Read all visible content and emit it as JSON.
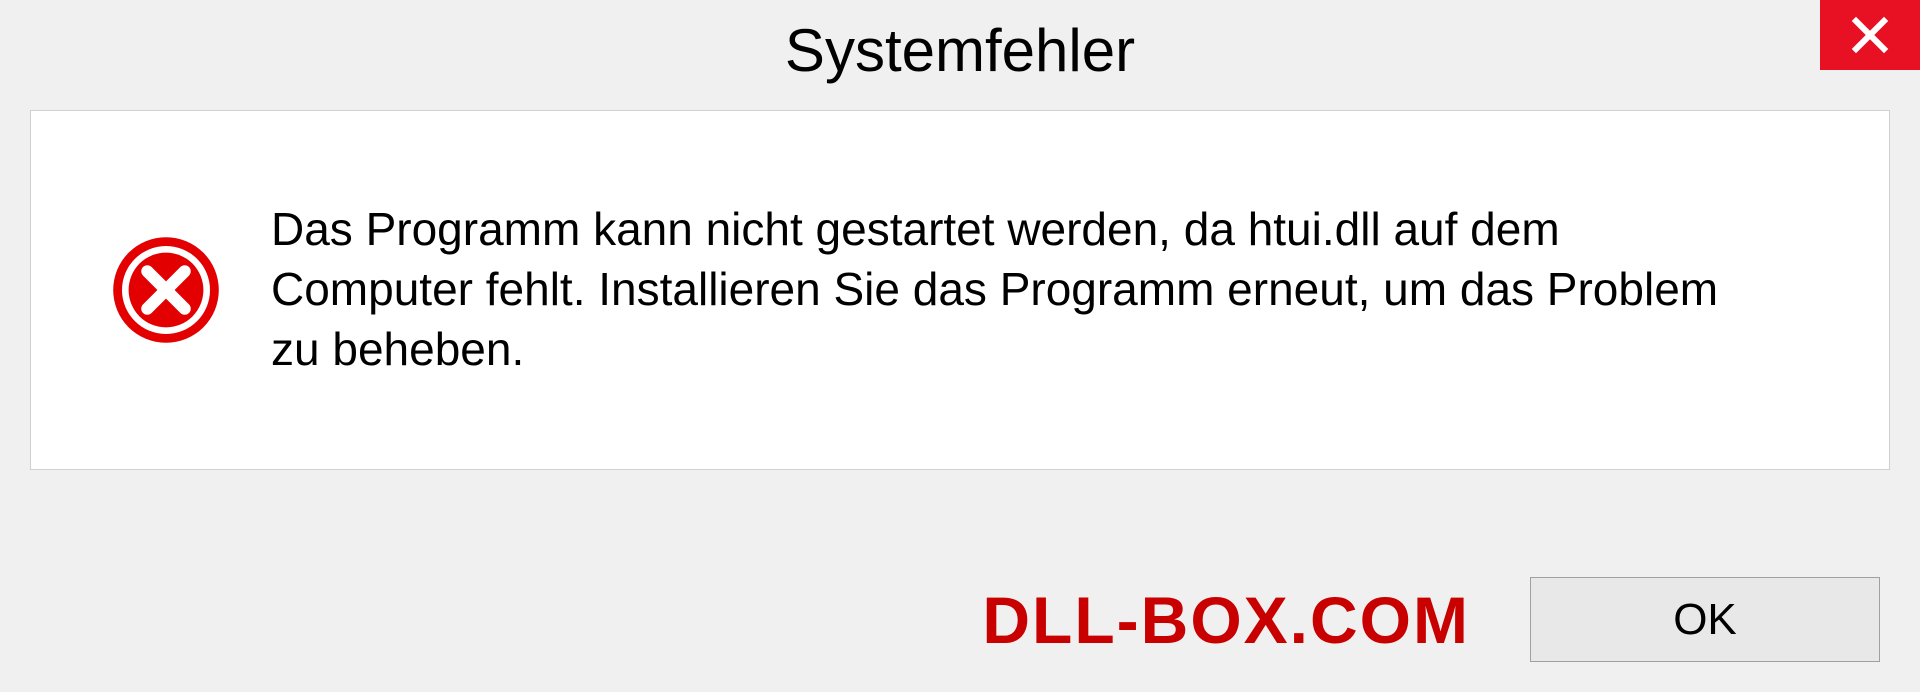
{
  "dialog": {
    "title": "Systemfehler",
    "message": "Das Programm kann nicht gestartet werden, da htui.dll auf dem Computer fehlt. Installieren Sie das Programm erneut, um das Problem zu beheben.",
    "ok_label": "OK"
  },
  "watermark": "DLL-BOX.COM"
}
